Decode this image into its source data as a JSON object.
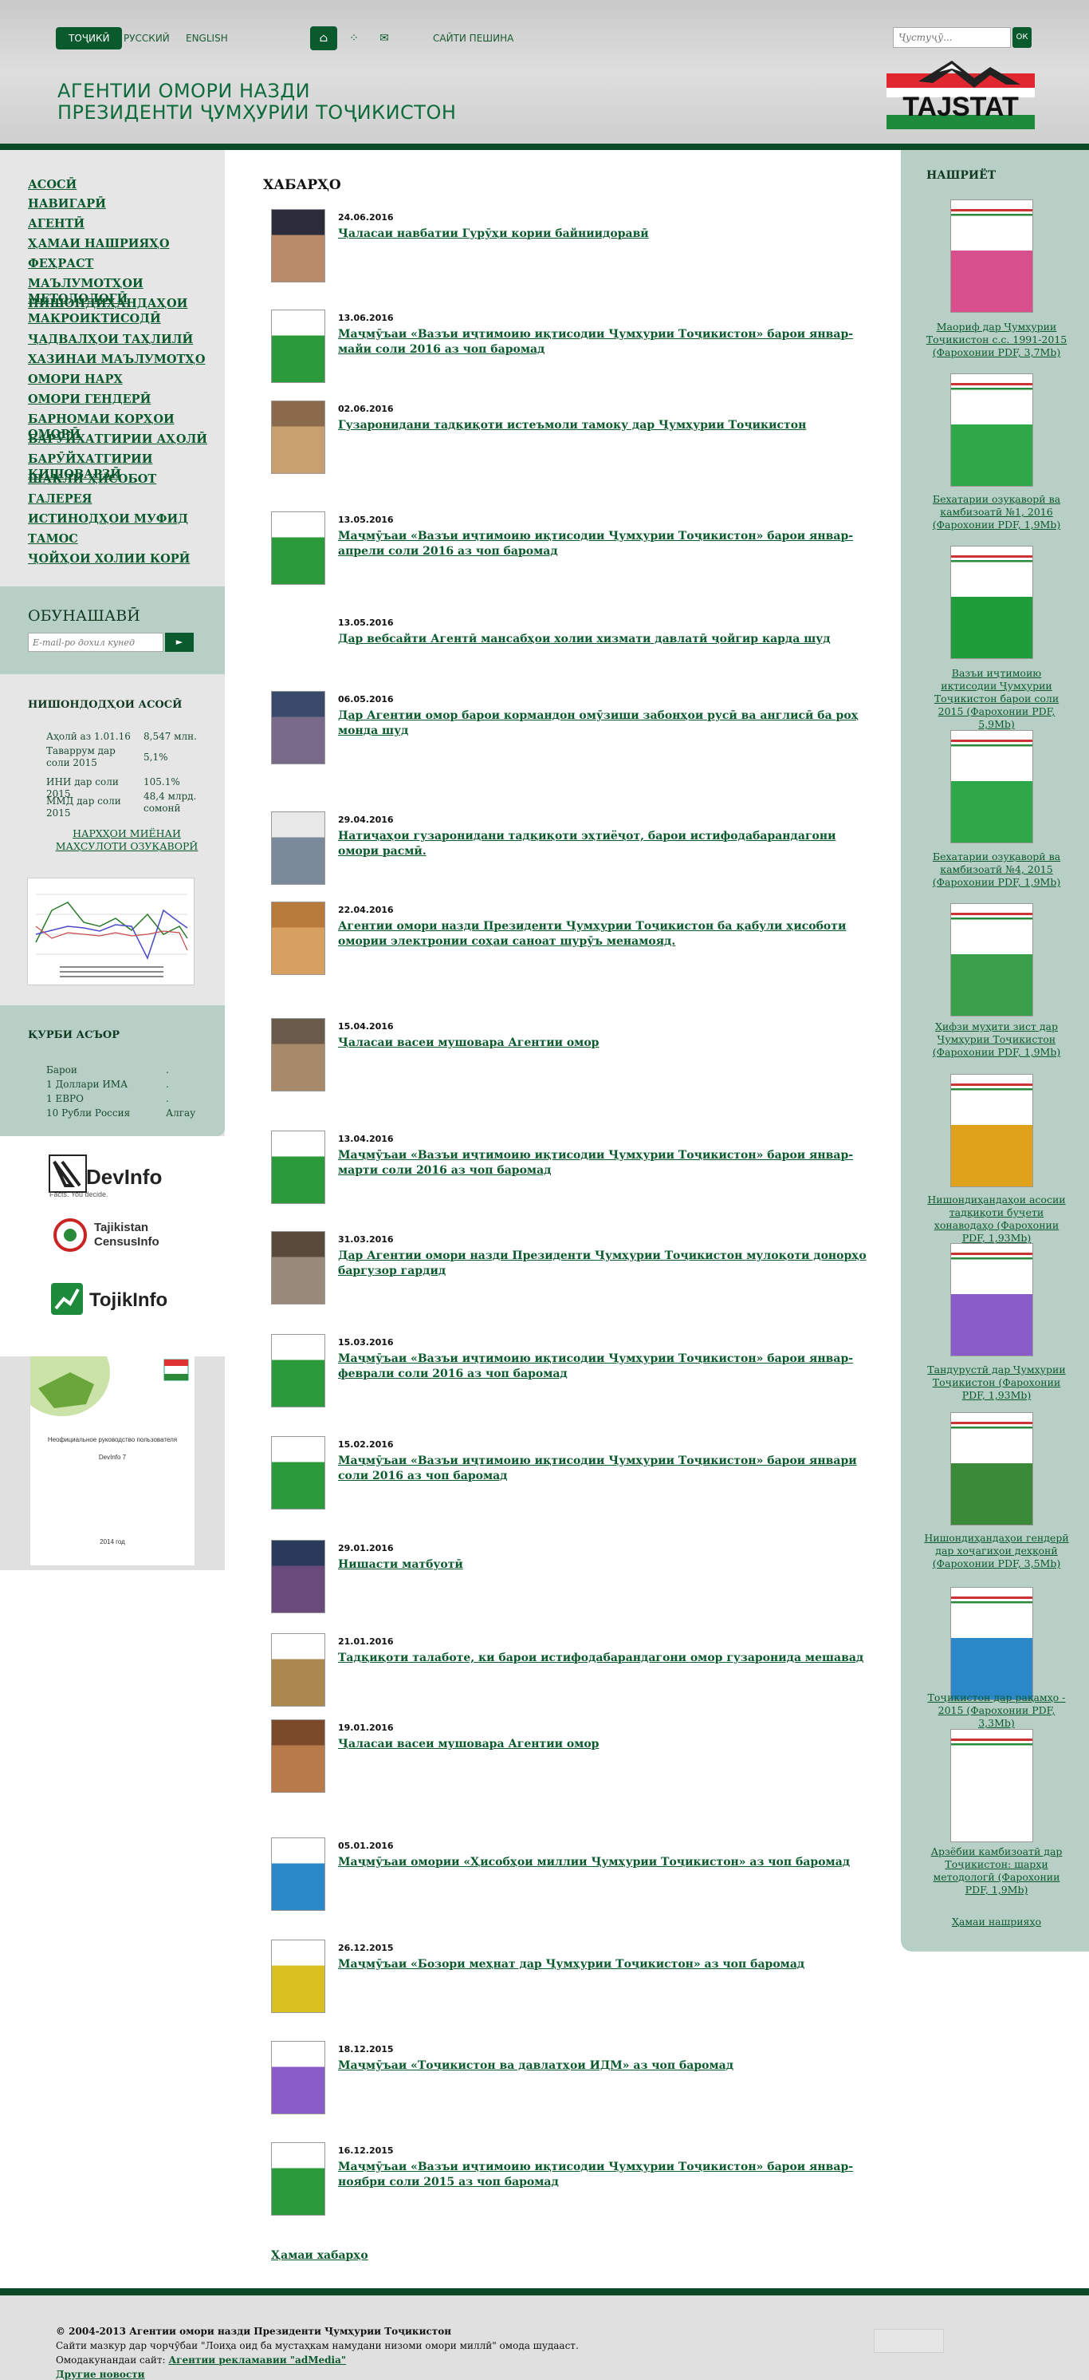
{
  "header": {
    "lang_tj": "ТОҶИКӢ",
    "lang_ru": "РУССКИЙ",
    "lang_en": "ENGLISH",
    "old_site": "САЙТИ ПЕШИНА",
    "title_line1": "АГЕНТИИ ОМОРИ НАЗДИ",
    "title_line2": "ПРЕЗИДЕНТИ ҶУМҲУРИИ ТОҶИКИСТОН",
    "search_placeholder": "Ҷустуҷӯ...",
    "search_btn": "ОК",
    "logo_text": "TAJSTAT",
    "icons": [
      "home-icon",
      "sitemap-icon",
      "mail-icon"
    ]
  },
  "nav": [
    "АСОСӢ",
    "НАВИГАРӢ",
    "АГЕНТӢ",
    "ҲАМАИ НАШРИЯҲО",
    "ФЕҲРАСТ",
    "МАЪЛУМОТҲОИ МЕТОДОЛОГӢ",
    "НИШОНДИҲАНДАҲОИ МАКРОИКТИСОДӢ",
    "ҶАДВАЛҲОИ ТАҲЛИЛӢ",
    "ХАЗИНАИ МАЪЛУМОТҲО",
    "ОМОРИ НАРХ",
    "ОМОРИ ГЕНДЕРӢ",
    "БАРНОМАИ КОРҲОИ ОМОРӢ",
    "БАРӮЙХАТГИРИИ АҲОЛӢ",
    "БАРӮЙХАТГИРИИ КИШОВАРЗӢ",
    "ШАКЛИ ҲИСОБОТ",
    "ГАЛЕРЕЯ",
    "ИСТИНОДҲОИ МУФИД",
    "ТАМОС",
    "ҶОЙҲОИ ХОЛИИ КОРӢ"
  ],
  "subscribe": {
    "title": "ОБУНАШАВӢ",
    "placeholder": "E-mail-ро дохил кунед"
  },
  "indicators": {
    "title": "НИШОНДОДҲОИ АСОСӢ",
    "rows": [
      {
        "label": "Аҳолӣ аз 1.01.16",
        "value": "8,547 млн."
      },
      {
        "label": "Таваррум дар соли 2015",
        "value": "5,1%"
      },
      {
        "label": "ИНИ дар соли 2015",
        "value": "105.1%"
      },
      {
        "label": "ММД дар соли 2015",
        "value": "48,4 млрд. сомонӣ"
      }
    ],
    "link": "НАРХҲОИ МИЁНАИ МАҲСУЛОТИ ОЗУҚАВОРӢ"
  },
  "rates": {
    "title": "ҚУРБИ АСЪОР",
    "rows": [
      {
        "label": "Барои",
        "value": "."
      },
      {
        "label": "1 Доллари ИМА",
        "value": "."
      },
      {
        "label": "1 ЕВРО",
        "value": "."
      },
      {
        "label": "10 Рубли Россия",
        "value": "Алгау"
      }
    ]
  },
  "partners": {
    "devinfo": "DevInfo",
    "devinfo_tag": "Facts. You decide.",
    "census": "Tajikistan CensusInfo",
    "tojik": "TojikInfo"
  },
  "booklet": {
    "text": "Неофициальное руководство пользователя",
    "sub": "DevInfo 7",
    "year": "2014 год"
  },
  "news": {
    "title": "ХАБАРҲО",
    "more": "Ҳамаи хабарҳо",
    "items": [
      {
        "date": "24.06.2016",
        "title": "Ҷаласаи навбатии Гурӯҳи кории байниидоравӣ"
      },
      {
        "date": "13.06.2016",
        "title": "Маҷмӯъаи «Вазъи иҷтимоию иқтисодии Ҷумҳурии Тоҷикистон» барои январ-майи соли 2016 аз чоп баромад"
      },
      {
        "date": "02.06.2016",
        "title": "Гузаронидани тадқиқоти истеъмоли тамоку дар Ҷумҳурии Тоҷикистон"
      },
      {
        "date": "13.05.2016",
        "title": "Маҷмӯъаи «Вазъи иҷтимоию иқтисодии Ҷумҳурии Тоҷикистон» барои январ-апрели соли 2016 аз чоп баромад"
      },
      {
        "date": "13.05.2016",
        "title": "Дар вебсайти Агентӣ мансабҳои холии хизмати давлатӣ ҷойгир карда шуд"
      },
      {
        "date": "06.05.2016",
        "title": "Дар Агентии омор барои кормандон омӯзиши забонҳои русӣ ва англисӣ ба роҳ монда шуд"
      },
      {
        "date": "29.04.2016",
        "title": "Натиҷаҳои гузаронидани тадқиқоти эҳтиёҷот, барои истифодабарандагони омори расмӣ."
      },
      {
        "date": "22.04.2016",
        "title": "Агентии омори назди Президенти Ҷумҳурии Тоҷикистон ба қабули ҳисоботи омории электронии соҳаи саноат шурӯъ менамояд."
      },
      {
        "date": "15.04.2016",
        "title": "Ҷаласаи васеи мушовара Агентии омор"
      },
      {
        "date": "13.04.2016",
        "title": "Маҷмӯъаи «Вазъи иҷтимоию иқтисодии Ҷумҳурии Тоҷикистон» барои январ-марти соли 2016 аз чоп баромад"
      },
      {
        "date": "31.03.2016",
        "title": "Дар Агентии омори назди Президенти Ҷумҳурии Тоҷикистон мулоқоти донорҳо баргузор гардид"
      },
      {
        "date": "15.03.2016",
        "title": "Маҷмӯъаи «Вазъи иҷтимоию иқтисодии Ҷумҳурии Тоҷикистон» барои январ-феврали соли 2016 аз чоп баромад"
      },
      {
        "date": "15.02.2016",
        "title": "Маҷмӯъаи «Вазъи иҷтимоию иқтисодии Ҷумҳурии Тоҷикистон» барои январи соли 2016 аз чоп баромад"
      },
      {
        "date": "29.01.2016",
        "title": "Нишасти матбуотӣ"
      },
      {
        "date": "21.01.2016",
        "title": "Тадқиқоти талаботе, ки барои истифодабарандагони омор гузаронида мешавад"
      },
      {
        "date": "19.01.2016",
        "title": "Ҷаласаи васеи мушовара Агентии омор"
      },
      {
        "date": "05.01.2016",
        "title": "Маҷмӯъаи омории «Ҳисобҳои миллии Ҷумҳурии Тоҷикистон» аз чоп баромад"
      },
      {
        "date": "26.12.2015",
        "title": "Маҷмӯъаи «Бозори меҳнат дар Ҷумҳурии Тоҷикистон» аз чоп баромад"
      },
      {
        "date": "18.12.2015",
        "title": "Маҷмӯъаи «Тоҷикистон ва давлатҳои ИДМ» аз чоп баромад"
      },
      {
        "date": "16.12.2015",
        "title": "Маҷмӯъаи «Вазъи иҷтимоию иқтисодии Ҷумҳурии Тоҷикистон» барои январ-ноябри соли 2015 аз чоп баромад"
      }
    ]
  },
  "publications": {
    "title": "НАШРИЁТ",
    "more": "Ҳамаи нашрияҳо",
    "items": [
      {
        "title": "Маориф дар Ҷумҳурии Тоҷикистон с.с. 1991-2015 (Фарохонии PDF, 3,7Mb)",
        "accent": "#d8508c"
      },
      {
        "title": "Бехатарии озуқаворӣ ва камбизоатӣ №1, 2016 (Фарохонии PDF, 1,9Mb)",
        "accent": "#2fa84a"
      },
      {
        "title": "Вазъи иҷтимоию иқтисодии Ҷумҳурии Тоҷикистон барои соли 2015 (Фарохонии PDF, 5,9Mb)",
        "accent": "#1f9d3a"
      },
      {
        "title": "Бехатарии озуқаворӣ ва камбизоатӣ №4, 2015 (Фарохонии PDF, 1,9Mb)",
        "accent": "#2fa84a"
      },
      {
        "title": "Ҳифзи муҳити зист дар Ҷумҳурии Тоҷикистон (Фарохонии PDF, 1,9Mb)",
        "accent": "#3aa04a"
      },
      {
        "title": "Нишондиҳандаҳои асосии тадқиқоти буҷети хонаводаҳо (Фарохонии PDF, 1,93Mb)",
        "accent": "#e0a21a"
      },
      {
        "title": "Тандурустӣ дар Ҷумҳурии Тоҷикистон (Фарохонии PDF, 1,93Mb)",
        "accent": "#8a5cc8"
      },
      {
        "title": "Нишондиҳандаҳои гендерӣ дар хоҷагиҳои деҳқонӣ (Фарохонии PDF, 3,5Mb)",
        "accent": "#3a8a3a"
      },
      {
        "title": "Тоҷикистон дар рақамҳо - 2015 (Фарохонии PDF, 3,3Mb)",
        "accent": "#2a88c8"
      },
      {
        "title": "Арзёбии камбизоатӣ дар Тоҷикистон: шарҳи методологӣ (Фарохонии PDF, 1,9Mb)",
        "accent": "#ffffff"
      }
    ]
  },
  "footer": {
    "copyright": "© 2004-2013 Агентии омори назди Президенти Ҷумҳурии Тоҷикистон",
    "note": "Сайти мазкур дар чорчӯбаи \"Лоиҳа оид ба мустаҳкам намудани низоми омори миллӣ\" омода шудааст.",
    "dev_label": "Омодакунандаи сайт:",
    "dev_link": "Агентии рекламавии \"adMedia\"",
    "other": "Другие новости"
  },
  "colors": {
    "brand": "#0b5a2e",
    "panel": "#b7cfc5",
    "left_bg": "#e6e6e6"
  }
}
